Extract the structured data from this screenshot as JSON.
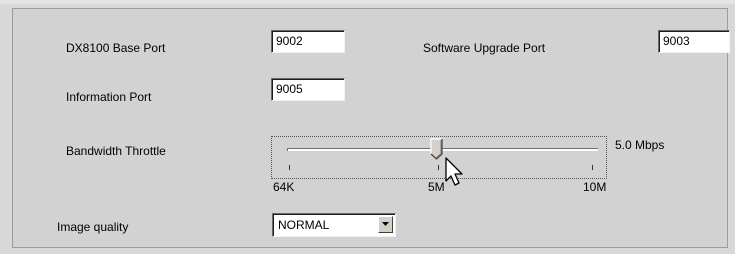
{
  "fields": {
    "base_port": {
      "label": "DX8100 Base Port",
      "value": "9002"
    },
    "upgrade_port": {
      "label": "Software Upgrade Port",
      "value": "9003"
    },
    "info_port": {
      "label": "Information Port",
      "value": "9005"
    }
  },
  "bandwidth": {
    "label": "Bandwidth Throttle",
    "value_text": "5.0 Mbps",
    "min_label": "64K",
    "mid_label": "5M",
    "max_label": "10M",
    "position_fraction": 0.5
  },
  "image_quality": {
    "label": "Image quality",
    "selected": "NORMAL"
  },
  "icons": {
    "dropdown": "chevron-down-icon",
    "cursor": "mouse-pointer-icon",
    "slider_thumb": "slider-thumb-icon"
  }
}
